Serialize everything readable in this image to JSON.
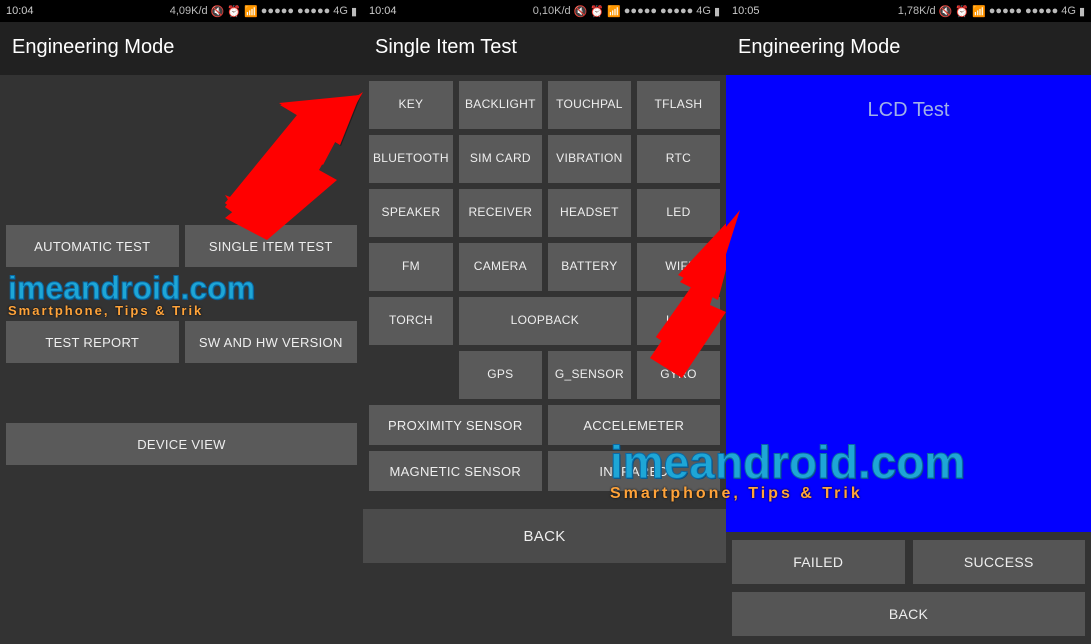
{
  "statusbar": {
    "s1_time": "10:04",
    "s2_time": "10:04",
    "s3_time": "10:05",
    "s1_speed": "4,09K/d",
    "s2_speed": "0,10K/d",
    "s3_speed": "1,78K/d",
    "net_label": "4G",
    "silent_icon": "🔇",
    "alarm_icon": "⏰",
    "wifi_icon": "📶",
    "dots": "●●●●●",
    "batt_icon": "▮"
  },
  "screen1": {
    "title": "Engineering Mode",
    "auto_test": "AUTOMATIC TEST",
    "single_item": "SINGLE ITEM TEST",
    "test_report": "TEST REPORT",
    "sw_hw": "SW AND HW VERSION",
    "device_view": "DEVICE VIEW"
  },
  "screen2": {
    "title": "Single Item Test",
    "items": [
      "KEY",
      "BACKLIGHT",
      "TOUCHPAL",
      "TFLASH",
      "BLUETOOTH",
      "SIM CARD",
      "VIBRATION",
      "RTC",
      "SPEAKER",
      "RECEIVER",
      "HEADSET",
      "LED",
      "FM",
      "CAMERA",
      "BATTERY",
      "WIFI",
      "TORCH",
      "LOOPBACK",
      "LCD",
      "GPS",
      "G_SENSOR",
      "GYRO"
    ],
    "proximity": "PROXIMITY SENSOR",
    "accelerometer": "ACCELEMETER",
    "magnetic": "MAGNETIC SENSOR",
    "infrared": "INFRARED",
    "back": "BACK"
  },
  "screen3": {
    "title": "Engineering Mode",
    "lcd_label": "LCD Test",
    "failed": "FAILED",
    "success": "SUCCESS",
    "back": "BACK"
  },
  "watermark": {
    "main": "imeandroid.com",
    "sub": "Smartphone, Tips & Trik"
  }
}
